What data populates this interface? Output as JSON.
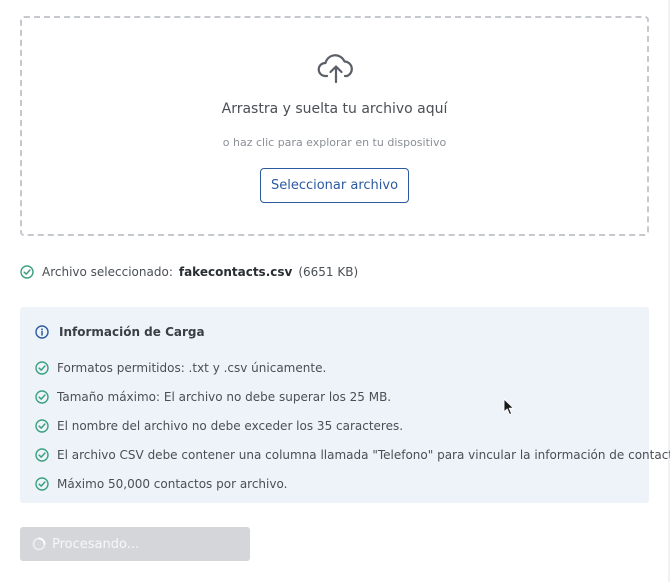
{
  "dropzone": {
    "icon": "cloud-upload-icon",
    "title": "Arrastra y suelta tu archivo aquí",
    "subtitle": "o haz clic para explorar en tu dispositivo",
    "button_label": "Seleccionar archivo"
  },
  "selected_file": {
    "icon": "check-circle-icon",
    "label": "Archivo seleccionado:",
    "name": "fakecontacts.csv",
    "size": "(6651 KB)"
  },
  "info": {
    "icon": "info-circle-icon",
    "title": "Información de Carga",
    "items": [
      "Formatos permitidos: .txt y .csv únicamente.",
      "Tamaño máximo: El archivo no debe superar los 25 MB.",
      "El nombre del archivo no debe exceder los 35 caracteres.",
      "El archivo CSV debe contener una columna llamada \"Telefono\" para vincular la información de contacto.",
      "Máximo 50,000 contactos por archivo."
    ]
  },
  "submit": {
    "label": "Procesando...",
    "state": "loading"
  },
  "colors": {
    "accent": "#2c5aa0",
    "success": "#3aa17e",
    "info_bg": "#eef3f9",
    "dropzone_border": "#c5c9ce",
    "disabled_button": "#d4d6d9"
  }
}
